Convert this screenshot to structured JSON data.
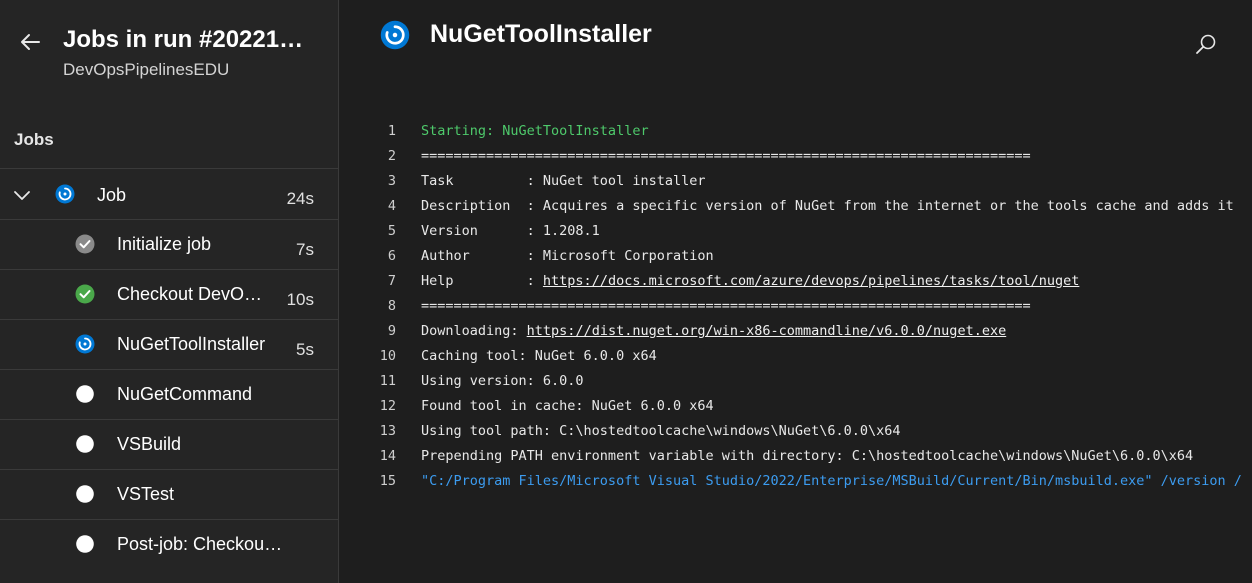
{
  "sidebar": {
    "run_title": "Jobs in run #20221…",
    "org": "DevOpsPipelinesEDU",
    "jobs_label": "Jobs",
    "job": {
      "label": "Job",
      "duration": "24s",
      "status": "running"
    },
    "steps": [
      {
        "label": "Initialize job",
        "duration": "7s",
        "status": "succeeded-gray"
      },
      {
        "label": "Checkout DevO…",
        "duration": "10s",
        "status": "succeeded"
      },
      {
        "label": "NuGetToolInstaller",
        "duration": "5s",
        "status": "running"
      },
      {
        "label": "NuGetCommand",
        "duration": "",
        "status": "pending"
      },
      {
        "label": "VSBuild",
        "duration": "",
        "status": "pending"
      },
      {
        "label": "VSTest",
        "duration": "",
        "status": "pending"
      },
      {
        "label": "Post-job: Checkout …",
        "duration": "",
        "status": "pending"
      }
    ]
  },
  "main": {
    "title": "NuGetToolInstaller",
    "log": [
      {
        "n": "1",
        "parts": [
          {
            "t": "Starting: NuGetToolInstaller"
          }
        ],
        "color": "green"
      },
      {
        "n": "2",
        "parts": [
          {
            "t": "==========================================================================="
          }
        ]
      },
      {
        "n": "3",
        "parts": [
          {
            "t": "Task         : NuGet tool installer"
          }
        ]
      },
      {
        "n": "4",
        "parts": [
          {
            "t": "Description  : Acquires a specific version of NuGet from the internet or the tools cache and adds it"
          }
        ]
      },
      {
        "n": "5",
        "parts": [
          {
            "t": "Version      : 1.208.1"
          }
        ]
      },
      {
        "n": "6",
        "parts": [
          {
            "t": "Author       : Microsoft Corporation"
          }
        ]
      },
      {
        "n": "7",
        "parts": [
          {
            "t": "Help         : "
          },
          {
            "t": "https://docs.microsoft.com/azure/devops/pipelines/tasks/tool/nuget",
            "link": true
          }
        ]
      },
      {
        "n": "8",
        "parts": [
          {
            "t": "==========================================================================="
          }
        ]
      },
      {
        "n": "9",
        "parts": [
          {
            "t": "Downloading: "
          },
          {
            "t": "https://dist.nuget.org/win-x86-commandline/v6.0.0/nuget.exe",
            "link": true
          }
        ]
      },
      {
        "n": "10",
        "parts": [
          {
            "t": "Caching tool: NuGet 6.0.0 x64"
          }
        ]
      },
      {
        "n": "11",
        "parts": [
          {
            "t": "Using version: 6.0.0"
          }
        ]
      },
      {
        "n": "12",
        "parts": [
          {
            "t": "Found tool in cache: NuGet 6.0.0 x64"
          }
        ]
      },
      {
        "n": "13",
        "parts": [
          {
            "t": "Using tool path: C:\\hostedtoolcache\\windows\\NuGet\\6.0.0\\x64"
          }
        ]
      },
      {
        "n": "14",
        "parts": [
          {
            "t": "Prepending PATH environment variable with directory: C:\\hostedtoolcache\\windows\\NuGet\\6.0.0\\x64"
          }
        ]
      },
      {
        "n": "15",
        "parts": [
          {
            "t": "\"C:/Program Files/Microsoft Visual Studio/2022/Enterprise/MSBuild/Current/Bin/msbuild.exe\" /version /"
          }
        ],
        "color": "blue"
      }
    ]
  },
  "icons": {
    "back": "arrow-left-icon",
    "expand": "chevron-down-icon",
    "search": "search-icon",
    "running": "running-status-icon",
    "succeeded": "check-circle-icon",
    "pending": "pending-circle-icon"
  },
  "colors": {
    "running": "#0078d4",
    "succeeded": "#4aa84a",
    "succeeded_gray": "#8a8a8a",
    "pending": "#ffffff",
    "log_green": "#4ec96b",
    "log_blue": "#3c9cf0"
  }
}
